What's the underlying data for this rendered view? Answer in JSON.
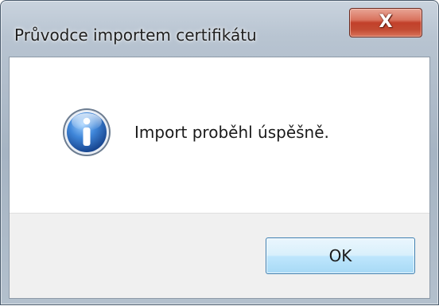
{
  "window": {
    "title": "Průvodce importem certifikátu"
  },
  "title_bar": {
    "close_glyph": "X",
    "close_icon": "close-icon"
  },
  "message": {
    "icon": "info-icon",
    "text": "Import proběhl úspěšně."
  },
  "buttons": {
    "ok_label": "OK"
  },
  "colors": {
    "close_button": "#c2402a",
    "ok_button_border": "#3c7fb1",
    "info_icon_blue": "#1f5fb0",
    "footer_background": "#f0f0f0"
  }
}
